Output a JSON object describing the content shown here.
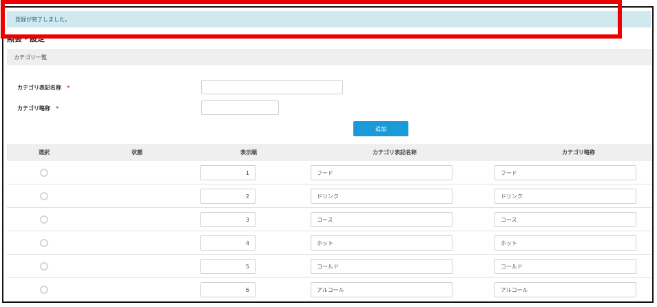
{
  "alert": {
    "message": "登録が完了しました。"
  },
  "page": {
    "title": "照会・設定"
  },
  "section": {
    "title": "カテゴリ一覧"
  },
  "form": {
    "display_name_label": "カテゴリ表記名称",
    "short_name_label": "カテゴリ略称",
    "required_mark": "*",
    "display_name_value": "",
    "short_name_value": "",
    "add_button": "追加"
  },
  "table": {
    "headers": [
      "選択",
      "状態",
      "表示順",
      "カテゴリ表記名称",
      "カテゴリ略称"
    ],
    "rows": [
      {
        "order": "1",
        "display_name": "フード",
        "short_name": "フード"
      },
      {
        "order": "2",
        "display_name": "ドリンク",
        "short_name": "ドリンク"
      },
      {
        "order": "3",
        "display_name": "コース",
        "short_name": "コース"
      },
      {
        "order": "4",
        "display_name": "ホット",
        "short_name": "ホット"
      },
      {
        "order": "5",
        "display_name": "コールド",
        "short_name": "コールド"
      },
      {
        "order": "6",
        "display_name": "アルコール",
        "short_name": "アルコール"
      }
    ]
  },
  "colors": {
    "alert_bg": "#cfe9ef",
    "accent": "#1a9bd7",
    "highlight": "#ee0000"
  }
}
